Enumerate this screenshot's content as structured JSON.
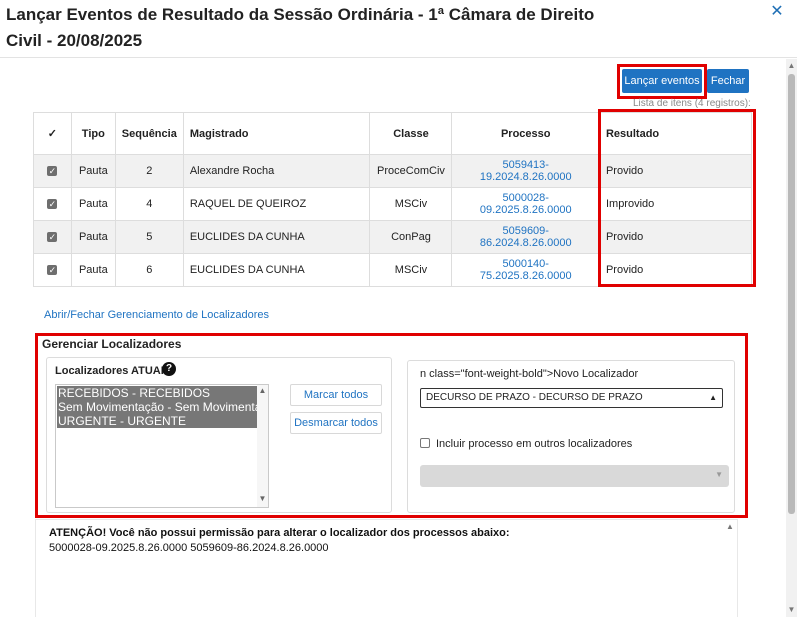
{
  "dialog": {
    "title_line1": "Lançar Eventos de Resultado da Sessão Ordinária - 1ª Câmara de Direito",
    "title_line2": "Civil - 20/08/2025",
    "close_glyph": "✕"
  },
  "toolbar": {
    "launch_label": "Lançar eventos",
    "close_label": "Fechar",
    "list_count": "Lista de itens (4 registros):"
  },
  "table": {
    "headers": [
      "✓",
      "Tipo",
      "Sequência",
      "Magistrado",
      "Classe",
      "Processo",
      "Resultado"
    ],
    "rows": [
      {
        "checked": "✓",
        "tipo": "Pauta",
        "sequencia": "2",
        "magistrado": "Alexandre Rocha",
        "classe": "ProceComCiv",
        "processo": "5059413-19.2024.8.26.0000",
        "resultado": "Provido"
      },
      {
        "checked": "✓",
        "tipo": "Pauta",
        "sequencia": "4",
        "magistrado": "RAQUEL DE QUEIROZ",
        "classe": "MSCiv",
        "processo": "5000028-09.2025.8.26.0000",
        "resultado": "Improvido"
      },
      {
        "checked": "✓",
        "tipo": "Pauta",
        "sequencia": "5",
        "magistrado": "EUCLIDES DA CUNHA",
        "classe": "ConPag",
        "processo": "5059609-86.2024.8.26.0000",
        "resultado": "Provido"
      },
      {
        "checked": "✓",
        "tipo": "Pauta",
        "sequencia": "6",
        "magistrado": "EUCLIDES DA CUNHA",
        "classe": "MSCiv",
        "processo": "5000140-75.2025.8.26.0000",
        "resultado": "Provido"
      }
    ]
  },
  "locators": {
    "toggle_link": "Abrir/Fechar Gerenciamento de Localizadores",
    "section_title": "Gerenciar Localizadores",
    "current_label": "Localizadores ATUAIS",
    "help_glyph": "?",
    "current_items": [
      "RECEBIDOS - RECEBIDOS",
      "Sem Movimentação - Sem Movimentação",
      "URGENTE - URGENTE"
    ],
    "mark_all": "Marcar todos",
    "unmark_all": "Desmarcar todos",
    "new_label": "n class=\"font-weight-bold\">Novo Localizador",
    "new_selected": "DECURSO DE PRAZO - DECURSO DE PRAZO",
    "include_other_label": "Incluir processo em outros localizadores",
    "disabled_select_value": ""
  },
  "warning": {
    "title": "ATENÇÃO! Você não possui permissão para alterar o localizador dos processos abaixo:",
    "processes": "5000028-09.2025.8.26.0000 5059609-86.2024.8.26.0000"
  },
  "colors": {
    "accent": "#1f73c2",
    "highlight_border": "#e00000",
    "selected_item_bg": "#777777"
  }
}
